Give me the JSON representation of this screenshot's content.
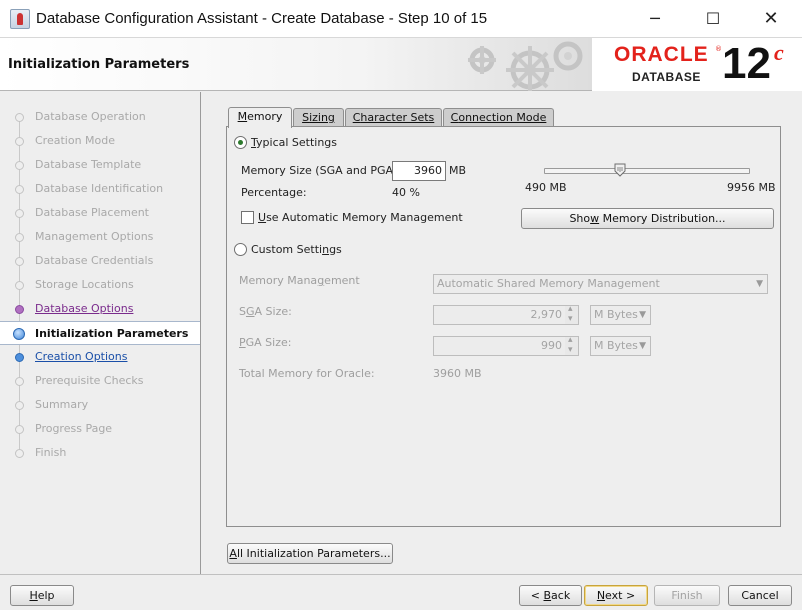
{
  "window": {
    "title": "Database Configuration Assistant - Create Database - Step 10 of 15",
    "minimize_glyph": "─",
    "maximize_glyph": "☐",
    "close_glyph": "✕"
  },
  "banner": {
    "page_title": "Initialization Parameters",
    "brand": "ORACLE",
    "brand_reg": "®",
    "product": "DATABASE",
    "version": "12",
    "version_suffix": "c"
  },
  "steps": [
    {
      "label": "Database Operation",
      "state": "disabled"
    },
    {
      "label": "Creation Mode",
      "state": "disabled"
    },
    {
      "label": "Database Template",
      "state": "disabled"
    },
    {
      "label": "Database Identification",
      "state": "disabled"
    },
    {
      "label": "Database Placement",
      "state": "disabled"
    },
    {
      "label": "Management Options",
      "state": "disabled"
    },
    {
      "label": "Database Credentials",
      "state": "disabled"
    },
    {
      "label": "Storage Locations",
      "state": "disabled"
    },
    {
      "label": "Database Options",
      "state": "visited"
    },
    {
      "label": "Initialization Parameters",
      "state": "current"
    },
    {
      "label": "Creation Options",
      "state": "link"
    },
    {
      "label": "Prerequisite Checks",
      "state": "disabled"
    },
    {
      "label": "Summary",
      "state": "disabled"
    },
    {
      "label": "Progress Page",
      "state": "disabled"
    },
    {
      "label": "Finish",
      "state": "disabled"
    }
  ],
  "tabs": {
    "memory": {
      "pre": "",
      "key": "M",
      "post": "emory"
    },
    "sizing": {
      "pre": "",
      "key": "S",
      "post": "izing"
    },
    "charsets": {
      "pre": "",
      "key": "C",
      "post": "haracter Sets"
    },
    "connection": {
      "pre": "C",
      "key": "o",
      "post": "nnection Mode"
    }
  },
  "memory": {
    "typical_pre": "",
    "typical_key": "T",
    "typical_post": "ypical Settings",
    "typical_selected": true,
    "memory_size_label": "Memory Size (SGA and PGA):",
    "memory_size_value": "3960",
    "memory_size_unit": "MB",
    "percentage_label": "Percentage:",
    "percentage_value": "40 %",
    "slider_min_label": "490 MB",
    "slider_max_label": "9956 MB",
    "slider_min": 490,
    "slider_max": 9956,
    "slider_value": 3960,
    "amm_pre": "",
    "amm_key": "U",
    "amm_post": "se Automatic Memory Management",
    "amm_checked": false,
    "show_dist_pre": "Sho",
    "show_dist_key": "w",
    "show_dist_post": " Memory Distribution...",
    "custom_pre": "Custom Setti",
    "custom_key": "n",
    "custom_post": "gs",
    "custom_selected": false,
    "memory_mgmt_pre": "Memory Mana",
    "memory_mgmt_key": "g",
    "memory_mgmt_post": "ement",
    "memory_mgmt_value": "Automatic Shared Memory Management",
    "sga_pre": "S",
    "sga_key": "G",
    "sga_post": "A Size:",
    "sga_value": "2,970",
    "sga_unit": "M Bytes",
    "pga_pre": "",
    "pga_key": "P",
    "pga_post": "GA Size:",
    "pga_value": "990",
    "pga_unit": "M Bytes",
    "total_label": "Total Memory for Oracle:",
    "total_value": "3960 MB"
  },
  "all_params_pre": "",
  "all_params_key": "A",
  "all_params_post": "ll Initialization Parameters...",
  "footer": {
    "help_pre": "",
    "help_key": "H",
    "help_post": "elp",
    "back_pre": "< ",
    "back_key": "B",
    "back_post": "ack",
    "next_pre": "",
    "next_key": "N",
    "next_post": "ext >",
    "finish_label": "Finish",
    "cancel_label": "Cancel"
  }
}
